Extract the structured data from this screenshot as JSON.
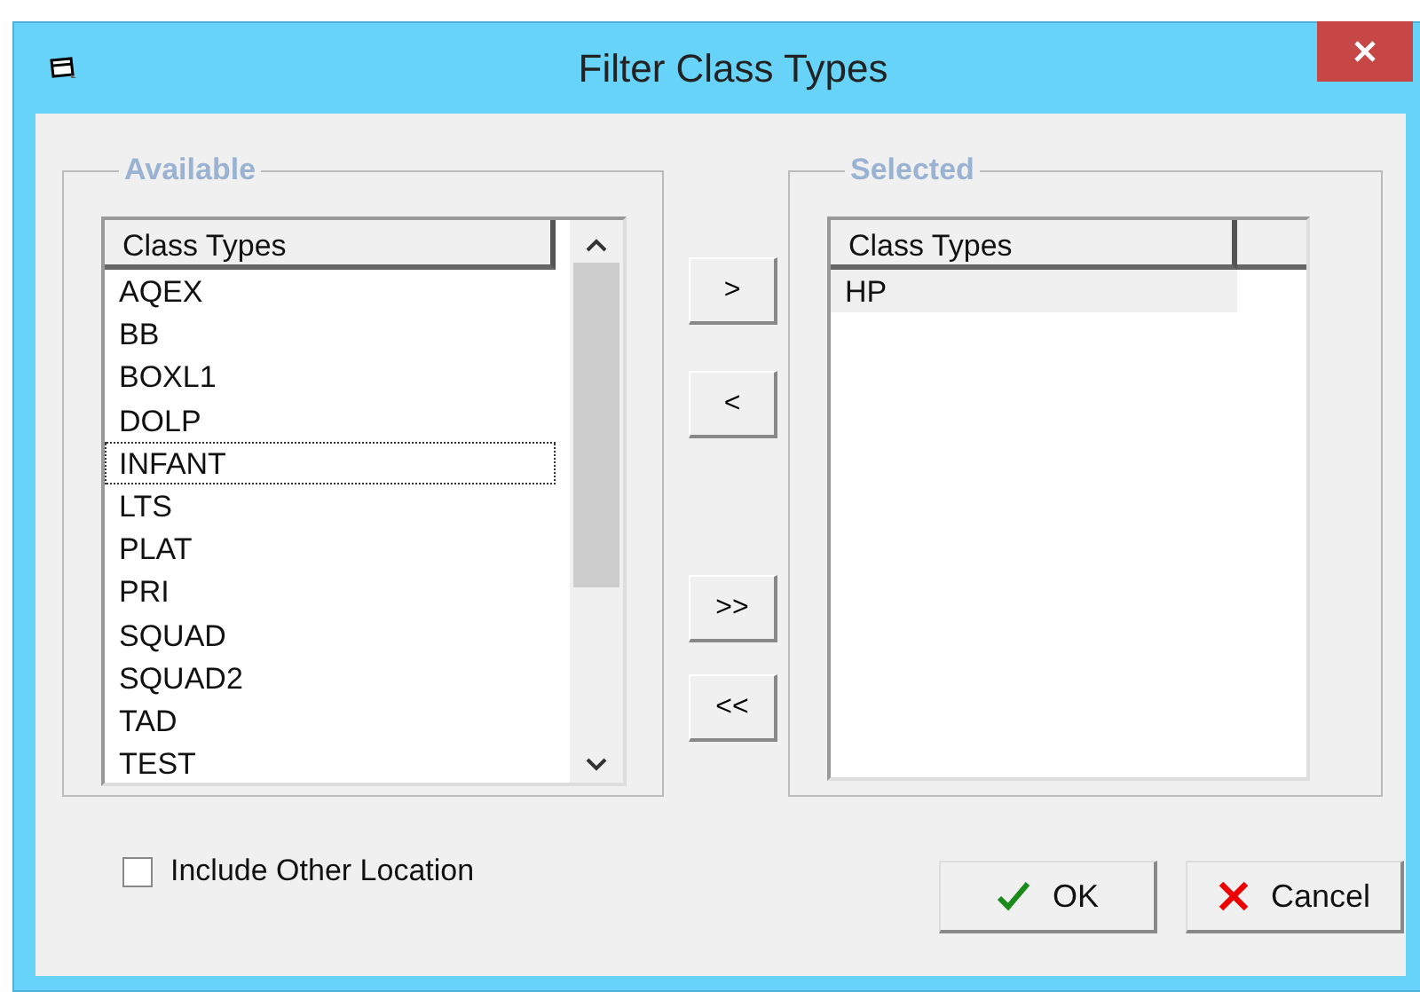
{
  "window": {
    "title": "Filter Class Types"
  },
  "available": {
    "title": "Available",
    "column": "Class Types",
    "items": [
      {
        "label": "AQEX",
        "selected": false,
        "focused": false
      },
      {
        "label": "BB",
        "selected": false,
        "focused": false
      },
      {
        "label": "BOXL1",
        "selected": false,
        "focused": false
      },
      {
        "label": "DOLP",
        "selected": false,
        "focused": false
      },
      {
        "label": "INFANT",
        "selected": false,
        "focused": true
      },
      {
        "label": "LTS",
        "selected": false,
        "focused": false
      },
      {
        "label": "PLAT",
        "selected": false,
        "focused": false
      },
      {
        "label": "PRI",
        "selected": false,
        "focused": false
      },
      {
        "label": "SQUAD",
        "selected": false,
        "focused": false
      },
      {
        "label": "SQUAD2",
        "selected": false,
        "focused": false
      },
      {
        "label": "TAD",
        "selected": false,
        "focused": false
      },
      {
        "label": "TEST",
        "selected": false,
        "focused": false
      }
    ]
  },
  "move_buttons": [
    ">",
    "<",
    ">>",
    "<<"
  ],
  "selected": {
    "title": "Selected",
    "column": "Class Types",
    "items": [
      {
        "label": "HP",
        "selected": true,
        "focused": false
      }
    ]
  },
  "include_other_location": {
    "label": "Include Other Location",
    "checked": false
  },
  "buttons": [
    {
      "kind": "ok",
      "label": "OK"
    },
    {
      "kind": "cancel",
      "label": "Cancel"
    }
  ]
}
